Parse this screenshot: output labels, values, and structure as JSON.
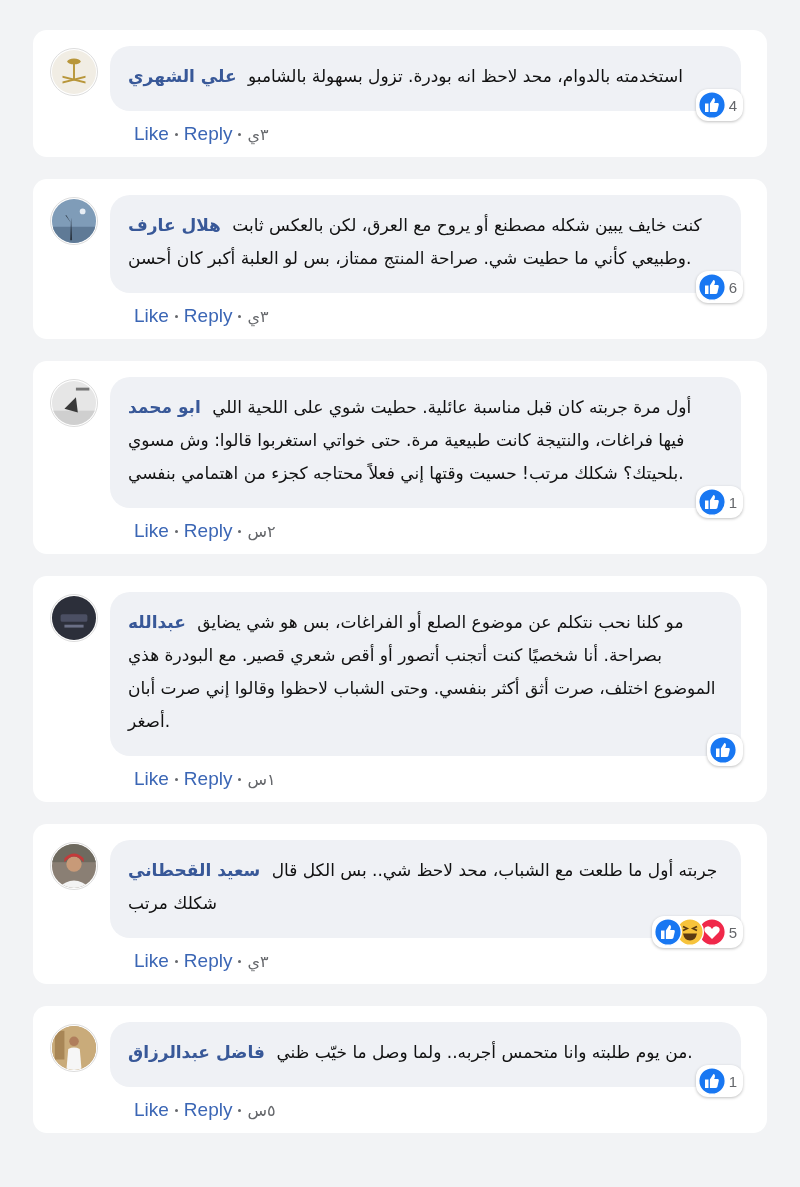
{
  "comments": [
    {
      "author": "علي الشهري",
      "text": "استخدمته بالدوام، محد لاحظ انه بودرة. تزول بسهولة بالشامبو",
      "reactions": [
        {
          "kind": "like"
        }
      ],
      "count": "4",
      "like": "Like",
      "reply": "Reply",
      "time": "٣ي"
    },
    {
      "author": "هلال عارف",
      "text": "كنت خايف يبين شكله مصطنع أو يروح مع العرق، لكن بالعكس ثابت وطبيعي كأني ما حطيت شي. صراحة المنتج ممتاز، بس لو العلبة أكبر كان أحسن.",
      "reactions": [
        {
          "kind": "like"
        }
      ],
      "count": "6",
      "like": "Like",
      "reply": "Reply",
      "time": "٣ي"
    },
    {
      "author": "ابو محمد",
      "text": "أول مرة جربته كان قبل مناسبة عائلية. حطيت شوي على اللحية اللي فيها فراغات، والنتيجة كانت طبيعية مرة. حتى خواتي استغربوا قالوا: وش مسوي بلحيتك؟ شكلك مرتب! حسيت وقتها إني فعلاً محتاجه كجزء من اهتمامي بنفسي.",
      "reactions": [
        {
          "kind": "like"
        }
      ],
      "count": "1",
      "like": "Like",
      "reply": "Reply",
      "time": "٢س"
    },
    {
      "author": "عبدالله",
      "text": "مو كلنا نحب نتكلم عن موضوع الصلع أو الفراغات، بس هو شي يضايق بصراحة. أنا شخصيًا كنت أتجنب أتصور أو أقص شعري قصير. مع البودرة هذي الموضوع اختلف، صرت أثق أكثر بنفسي. وحتى الشباب لاحظوا وقالوا إني صرت أبان أصغر.",
      "reactions": [
        {
          "kind": "like"
        }
      ],
      "like": "Like",
      "reply": "Reply",
      "time": "١س"
    },
    {
      "author": "سعيد القحطاني",
      "text": "جربته أول ما طلعت مع الشباب، محد لاحظ شي.. بس الكل قال شكلك مرتب",
      "reactions": [
        {
          "kind": "like"
        },
        {
          "kind": "haha"
        },
        {
          "kind": "love"
        }
      ],
      "count": "5",
      "like": "Like",
      "reply": "Reply",
      "time": "٣ي"
    },
    {
      "author": "فاضل عبدالرزاق",
      "text": "من يوم طلبته وانا متحمس أجربه.. ولما وصل ما خيّب ظني.",
      "reactions": [
        {
          "kind": "like"
        }
      ],
      "count": "1",
      "like": "Like",
      "reply": "Reply",
      "time": "٥س"
    }
  ]
}
